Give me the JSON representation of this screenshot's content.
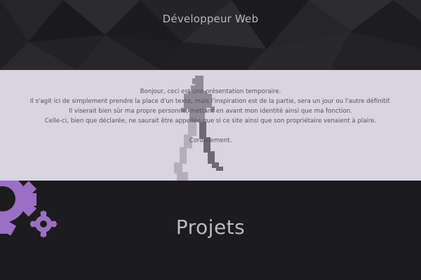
{
  "header": {
    "title": "Développeur Web"
  },
  "intro": {
    "lines": [
      "Bonjour, ceci est une présentation temporaire.",
      "Il s'agit ici de simplement prendre la place d'un texte, mais l'inspiration est de la partie, sera un jour ou l'autre définitif.",
      "Il viserait bien sûr ma propre personne, mettant en avant mon identité ainsi que ma fonction.",
      "Celle-ci, bien que déclarée, ne saurait être appellée que si ce site ainsi que son propriétaire venaient à plaire."
    ],
    "signature": "Cordialement."
  },
  "projects": {
    "title": "Projets"
  },
  "colors": {
    "accent": "#9b6fc3",
    "band": "#d9d4e1",
    "dark": "#1c1b1d"
  },
  "icons": [
    "walking-pixel-figure",
    "gear-large-icon",
    "gear-small-icon"
  ]
}
